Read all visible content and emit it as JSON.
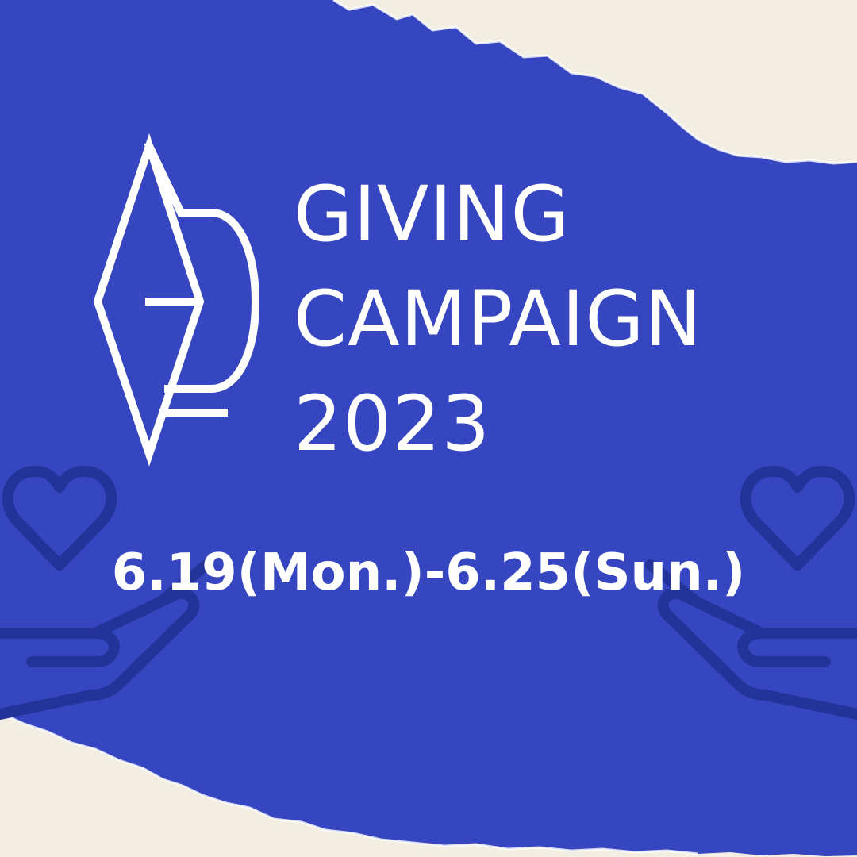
{
  "poster": {
    "title_line_1": "GIVING",
    "title_line_2": "CAMPAIGN",
    "title_line_3": "2023",
    "date_range": "6.19(Mon.)-6.25(Sun.)"
  },
  "colors": {
    "background_blue": "#3646C0",
    "torn_paper": "#F2EEE2",
    "icon_outline": "#24339A",
    "text": "#FFFFFF"
  },
  "icons": [
    "diamond-logo-icon",
    "heart-hands-icon"
  ]
}
